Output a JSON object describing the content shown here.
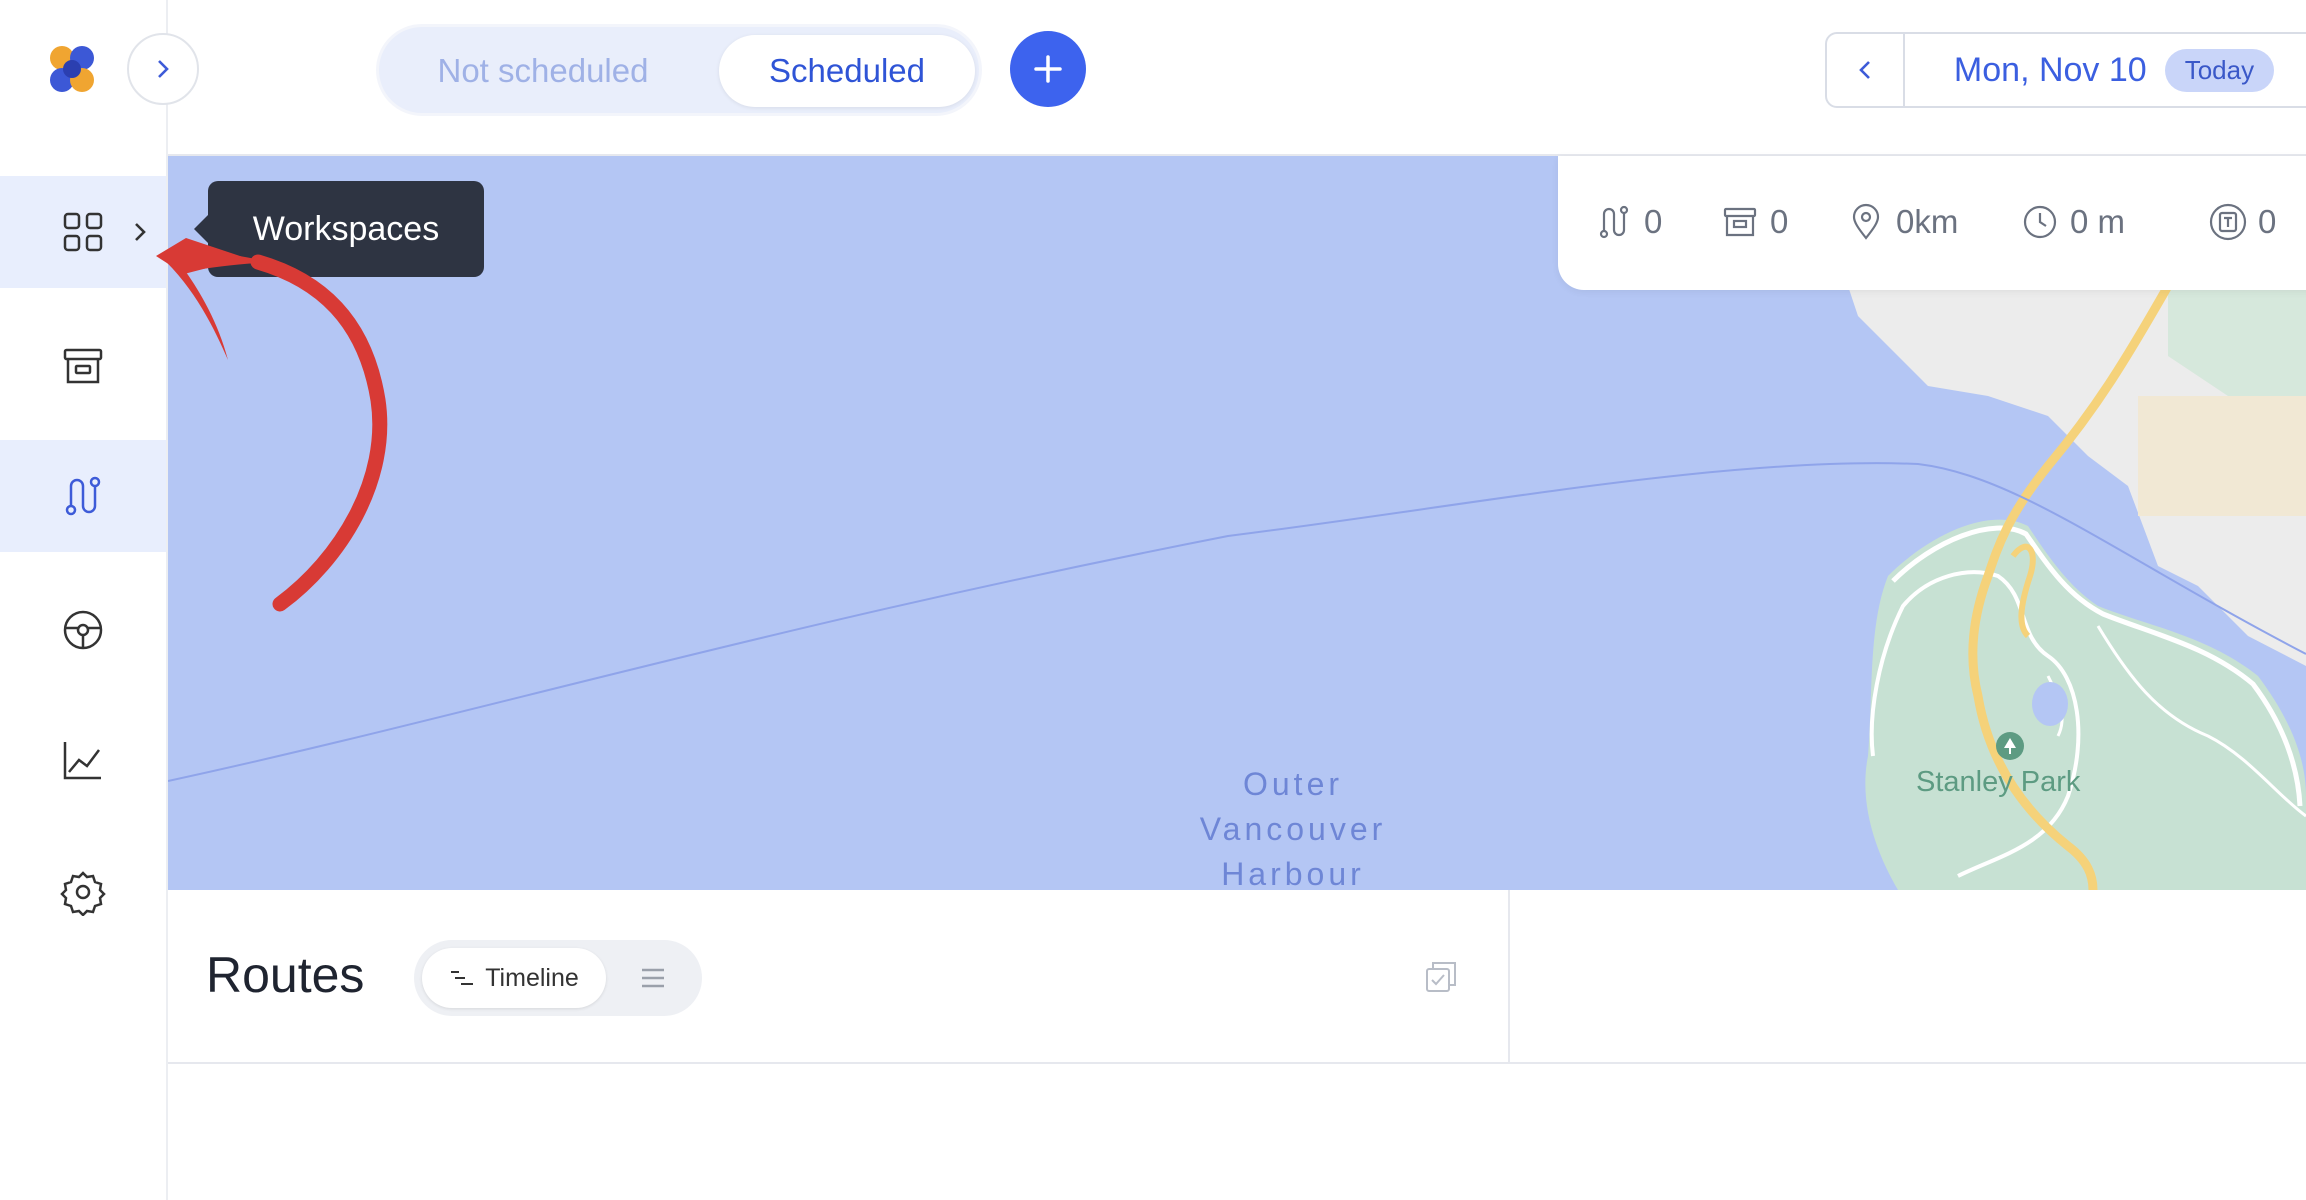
{
  "topbar": {
    "segmented": {
      "not_scheduled": "Not scheduled",
      "scheduled": "Scheduled",
      "selected": "Scheduled"
    },
    "date": {
      "label": "Mon, Nov 10",
      "badge": "Today"
    }
  },
  "sidebar": {
    "tooltip": "Workspaces",
    "items": [
      {
        "icon": "grid-icon",
        "active": true
      },
      {
        "icon": "archive-box-icon",
        "active": false
      },
      {
        "icon": "route-icon",
        "active": true
      },
      {
        "icon": "steering-wheel-icon",
        "active": false
      },
      {
        "icon": "chart-line-icon",
        "active": false
      },
      {
        "icon": "gear-icon",
        "active": false
      }
    ]
  },
  "stats": {
    "routes": "0",
    "orders": "0",
    "distance": "0km",
    "duration": "0 m",
    "capacity": "0"
  },
  "map": {
    "water_label": [
      "Outer",
      "Vancouver",
      "Harbour"
    ],
    "park_label": "Stanley Park"
  },
  "routes": {
    "title": "Routes",
    "timeline_label": "Timeline"
  },
  "colors": {
    "accent": "#3d63ee",
    "water": "#b4c6f4",
    "park": "#c7e1d3",
    "road": "#f5d27a",
    "tooltip_bg": "#2e3442",
    "annotation_arrow": "#d83a35"
  }
}
